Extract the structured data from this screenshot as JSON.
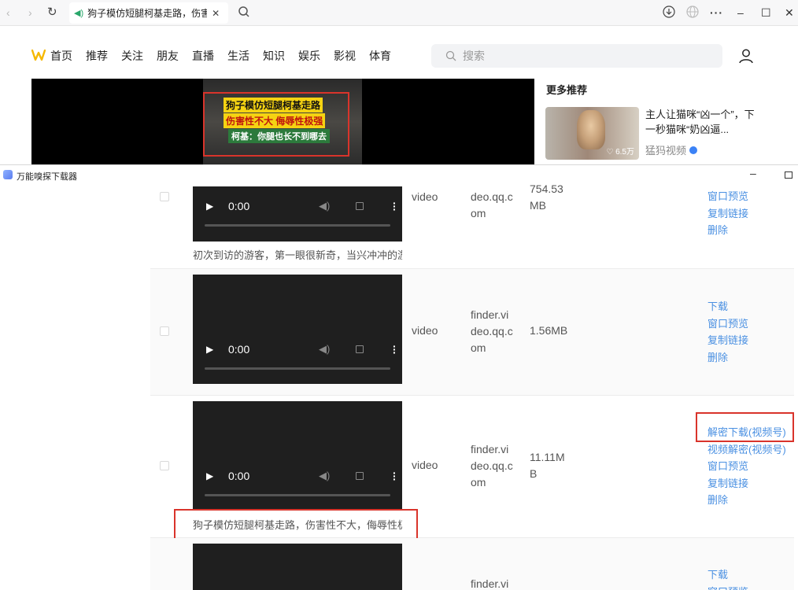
{
  "browser": {
    "tab_title": "狗子模仿短腿柯基走路，伤害性不大，侮辱性极强",
    "nav": {
      "back": "‹",
      "forward": "›",
      "reload": "↻"
    },
    "window_controls": {
      "more": "···",
      "minimize": "–",
      "maximize": "☐",
      "close": "✕"
    }
  },
  "site": {
    "nav_items": [
      "首页",
      "推荐",
      "关注",
      "朋友",
      "直播",
      "生活",
      "知识",
      "娱乐",
      "影视",
      "体育"
    ],
    "search_placeholder": "搜索",
    "brand_color": "#f5b800"
  },
  "video": {
    "caption_line1": "狗子模仿短腿柯基走路",
    "caption_line2": "伤害性不大 侮辱性极强",
    "caption_line3": "柯基：你腿也长不到哪去"
  },
  "recommend": {
    "title": "更多推荐",
    "item_text": "主人让猫咪“凶一个”，下一秒猫咪“奶凶逼...",
    "views": "♡ 6.5万",
    "source": "猛犸视频"
  },
  "downloader": {
    "title": "万能嗅探下载器",
    "minimize": "–",
    "link_color": "#4a90e2",
    "rows": [
      {
        "time": "0:00",
        "type": "video",
        "domain": "deo.qq.com",
        "size": "754.53MB",
        "actions": [
          "窗口预览",
          "复制链接",
          "删除"
        ],
        "desc": "初次到访的游客，第一眼很新奇，当兴冲冲的游"
      },
      {
        "time": "0:00",
        "type": "video",
        "domain": "finder.video.qq.com",
        "size": "1.56MB",
        "actions": [
          "下载",
          "窗口预览",
          "复制链接",
          "删除"
        ]
      },
      {
        "time": "0:00",
        "type": "video",
        "domain": "finder.video.qq.com",
        "size": "11.11MB",
        "actions": [
          "解密下载(视频号)",
          "视频解密(视频号)",
          "窗口预览",
          "复制链接",
          "删除"
        ],
        "desc": "狗子模仿短腿柯基走路，伤害性不大，侮辱性极"
      },
      {
        "domain": "finder.vi",
        "actions": [
          "下载",
          "窗口预览"
        ]
      }
    ]
  }
}
